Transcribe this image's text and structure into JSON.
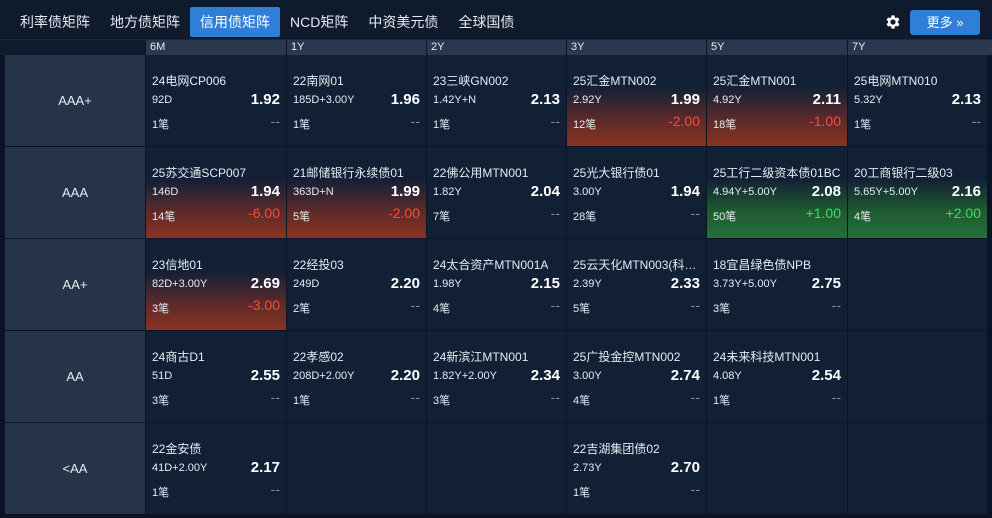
{
  "tabs": [
    {
      "label": "利率债矩阵",
      "active": false
    },
    {
      "label": "地方债矩阵",
      "active": false
    },
    {
      "label": "信用债矩阵",
      "active": true
    },
    {
      "label": "NCD矩阵",
      "active": false
    },
    {
      "label": "中资美元债",
      "active": false
    },
    {
      "label": "全球国债",
      "active": false
    }
  ],
  "toolbar": {
    "settings_icon": "gear-icon",
    "more_label": "更多 »"
  },
  "columns": [
    "6M",
    "1Y",
    "2Y",
    "3Y",
    "5Y",
    "7Y"
  ],
  "rows": [
    "AAA+",
    "AAA",
    "AA+",
    "AA",
    "<AA"
  ],
  "cells": {
    "r0c0": {
      "name": "24电网CP006",
      "term": "92D",
      "yield": "1.92",
      "count": "1笔",
      "change": "--",
      "tone": "none"
    },
    "r0c1": {
      "name": "22南网01",
      "term": "185D+3.00Y",
      "yield": "1.96",
      "count": "1笔",
      "change": "--",
      "tone": "none"
    },
    "r0c2": {
      "name": "23三峡GN002",
      "term": "1.42Y+N",
      "yield": "2.13",
      "count": "1笔",
      "change": "--",
      "tone": "none"
    },
    "r0c3": {
      "name": "25汇金MTN002",
      "term": "2.92Y",
      "yield": "1.99",
      "count": "12笔",
      "change": "-2.00",
      "tone": "red"
    },
    "r0c4": {
      "name": "25汇金MTN001",
      "term": "4.92Y",
      "yield": "2.11",
      "count": "18笔",
      "change": "-1.00",
      "tone": "red"
    },
    "r0c5": {
      "name": "25电网MTN010",
      "term": "5.32Y",
      "yield": "2.13",
      "count": "1笔",
      "change": "--",
      "tone": "none"
    },
    "r1c0": {
      "name": "25苏交通SCP007",
      "term": "146D",
      "yield": "1.94",
      "count": "14笔",
      "change": "-6.00",
      "tone": "red"
    },
    "r1c1": {
      "name": "21邮储银行永续债01",
      "term": "363D+N",
      "yield": "1.99",
      "count": "5笔",
      "change": "-2.00",
      "tone": "red"
    },
    "r1c2": {
      "name": "22佛公用MTN001",
      "term": "1.82Y",
      "yield": "2.04",
      "count": "7笔",
      "change": "--",
      "tone": "none"
    },
    "r1c3": {
      "name": "25光大银行债01",
      "term": "3.00Y",
      "yield": "1.94",
      "count": "28笔",
      "change": "--",
      "tone": "none"
    },
    "r1c4": {
      "name": "25工行二级资本债01BC",
      "term": "4.94Y+5.00Y",
      "yield": "2.08",
      "count": "50笔",
      "change": "+1.00",
      "tone": "green"
    },
    "r1c5": {
      "name": "20工商银行二级03",
      "term": "5.65Y+5.00Y",
      "yield": "2.16",
      "count": "4笔",
      "change": "+2.00",
      "tone": "green"
    },
    "r2c0": {
      "name": "23信地01",
      "term": "82D+3.00Y",
      "yield": "2.69",
      "count": "3笔",
      "change": "-3.00",
      "tone": "red"
    },
    "r2c1": {
      "name": "22经投03",
      "term": "249D",
      "yield": "2.20",
      "count": "2笔",
      "change": "--",
      "tone": "none"
    },
    "r2c2": {
      "name": "24太合资产MTN001A",
      "term": "1.98Y",
      "yield": "2.15",
      "count": "4笔",
      "change": "--",
      "tone": "none"
    },
    "r2c3": {
      "name": "25云天化MTN003(科…",
      "term": "2.39Y",
      "yield": "2.33",
      "count": "5笔",
      "change": "--",
      "tone": "none"
    },
    "r2c4": {
      "name": "18宜昌绿色债NPB",
      "term": "3.73Y+5.00Y",
      "yield": "2.75",
      "count": "3笔",
      "change": "--",
      "tone": "none"
    },
    "r3c0": {
      "name": "24商古D1",
      "term": "51D",
      "yield": "2.55",
      "count": "3笔",
      "change": "--",
      "tone": "none"
    },
    "r3c1": {
      "name": "22孝感02",
      "term": "208D+2.00Y",
      "yield": "2.20",
      "count": "1笔",
      "change": "--",
      "tone": "none"
    },
    "r3c2": {
      "name": "24新滨江MTN001",
      "term": "1.82Y+2.00Y",
      "yield": "2.34",
      "count": "3笔",
      "change": "--",
      "tone": "none"
    },
    "r3c3": {
      "name": "25广投金控MTN002",
      "term": "3.00Y",
      "yield": "2.74",
      "count": "4笔",
      "change": "--",
      "tone": "none"
    },
    "r3c4": {
      "name": "24未来科技MTN001",
      "term": "4.08Y",
      "yield": "2.54",
      "count": "1笔",
      "change": "--",
      "tone": "none"
    },
    "r4c0": {
      "name": "22金安债",
      "term": "41D+2.00Y",
      "yield": "2.17",
      "count": "1笔",
      "change": "--",
      "tone": "none"
    },
    "r4c3": {
      "name": "22吉湖集团债02",
      "term": "2.73Y",
      "yield": "2.70",
      "count": "1笔",
      "change": "--",
      "tone": "none"
    }
  },
  "colors": {
    "accent": "#2f7fd9",
    "negative": "#ff4a3a",
    "positive": "#3ddc6a"
  }
}
